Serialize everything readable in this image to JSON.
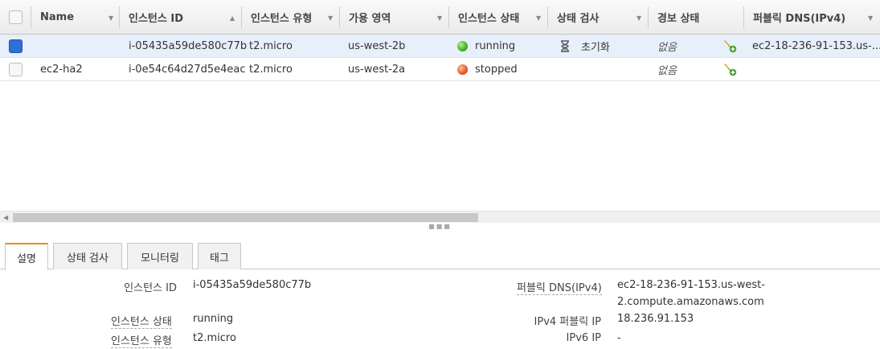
{
  "table": {
    "columns": [
      "Name",
      "인스턴스 ID",
      "인스턴스 유형",
      "가용 영역",
      "인스턴스 상태",
      "상태 검사",
      "경보 상태",
      "퍼블릭 DNS(IPv4)"
    ],
    "rows": [
      {
        "name": "",
        "id": "i-05435a59de580c77b",
        "type": "t2.micro",
        "zone": "us-west-2b",
        "state": "running",
        "check": "초기화",
        "alarm": "없음",
        "dns": "ec2-18-236-91-153.us-..."
      },
      {
        "name": "ec2-ha2",
        "id": "i-0e54c64d27d5e4eac",
        "type": "t2.micro",
        "zone": "us-west-2a",
        "state": "stopped",
        "check": "",
        "alarm": "없음",
        "dns": ""
      }
    ]
  },
  "tabs": [
    "설명",
    "상태 검사",
    "모니터링",
    "태그"
  ],
  "details": {
    "instance_id_label": "인스턴스 ID",
    "instance_id": "i-05435a59de580c77b",
    "instance_state_label": "인스턴스 상태",
    "instance_state": "running",
    "instance_type_label": "인스턴스 유형",
    "instance_type": "t2.micro",
    "public_dns_label": "퍼블릭 DNS(IPv4)",
    "public_dns_line1": "ec2-18-236-91-153.us-west-",
    "public_dns_line2": "2.compute.amazonaws.com",
    "ipv4_label": "IPv4 퍼블릭 IP",
    "ipv4": "18.236.91.153",
    "ipv6_label": "IPv6 IP",
    "ipv6": "-"
  },
  "colors": {
    "active_tab": "#e48f1a",
    "selected_row": "#e7effb",
    "checkbox_checked": "#2f6fd6"
  }
}
